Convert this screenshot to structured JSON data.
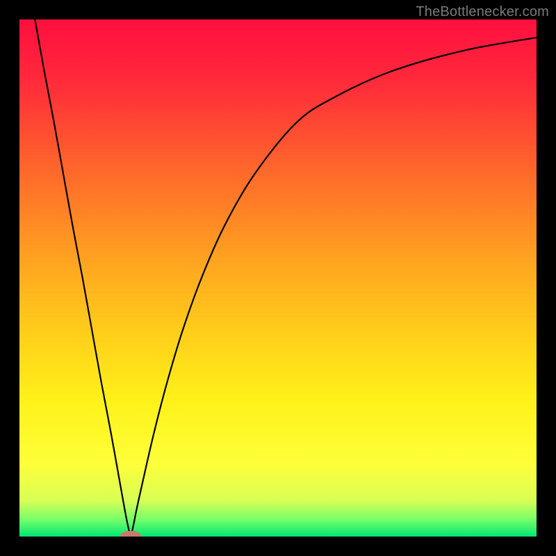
{
  "watermark": "TheBottlenecker.com",
  "chart_data": {
    "type": "line",
    "title": "",
    "xlabel": "",
    "ylabel": "",
    "xlim": [
      0,
      100
    ],
    "ylim": [
      0,
      100
    ],
    "grid": false,
    "legend": false,
    "gradient_stops": [
      {
        "offset": 0.0,
        "color": "#ff0f3f"
      },
      {
        "offset": 0.12,
        "color": "#ff2a3a"
      },
      {
        "offset": 0.3,
        "color": "#ff6a2a"
      },
      {
        "offset": 0.48,
        "color": "#ffa81f"
      },
      {
        "offset": 0.62,
        "color": "#ffd21a"
      },
      {
        "offset": 0.74,
        "color": "#fff21a"
      },
      {
        "offset": 0.86,
        "color": "#fdff3a"
      },
      {
        "offset": 0.93,
        "color": "#d8ff55"
      },
      {
        "offset": 0.965,
        "color": "#7dff68"
      },
      {
        "offset": 1.0,
        "color": "#00e874"
      }
    ],
    "marker": {
      "x": 21.5,
      "y": 0.2,
      "rx": 2.0,
      "ry": 0.9,
      "color": "#c97a6a"
    },
    "series": [
      {
        "name": "curve",
        "color": "#000000",
        "points": [
          {
            "x": 3.0,
            "y": 100.0
          },
          {
            "x": 4.8,
            "y": 90.0
          },
          {
            "x": 6.7,
            "y": 80.0
          },
          {
            "x": 8.5,
            "y": 70.0
          },
          {
            "x": 10.3,
            "y": 60.0
          },
          {
            "x": 12.2,
            "y": 50.0
          },
          {
            "x": 14.0,
            "y": 40.0
          },
          {
            "x": 15.8,
            "y": 30.0
          },
          {
            "x": 17.7,
            "y": 20.0
          },
          {
            "x": 19.5,
            "y": 10.0
          },
          {
            "x": 20.4,
            "y": 5.0
          },
          {
            "x": 21.0,
            "y": 2.0
          },
          {
            "x": 21.5,
            "y": 0.2
          },
          {
            "x": 22.0,
            "y": 2.0
          },
          {
            "x": 22.6,
            "y": 5.0
          },
          {
            "x": 23.7,
            "y": 10.0
          },
          {
            "x": 26.0,
            "y": 20.0
          },
          {
            "x": 28.6,
            "y": 30.0
          },
          {
            "x": 31.6,
            "y": 40.0
          },
          {
            "x": 35.2,
            "y": 50.0
          },
          {
            "x": 39.6,
            "y": 60.0
          },
          {
            "x": 45.4,
            "y": 70.0
          },
          {
            "x": 53.5,
            "y": 80.0
          },
          {
            "x": 61.0,
            "y": 85.0
          },
          {
            "x": 72.0,
            "y": 90.0
          },
          {
            "x": 86.0,
            "y": 94.0
          },
          {
            "x": 100.0,
            "y": 96.5
          }
        ]
      }
    ]
  }
}
